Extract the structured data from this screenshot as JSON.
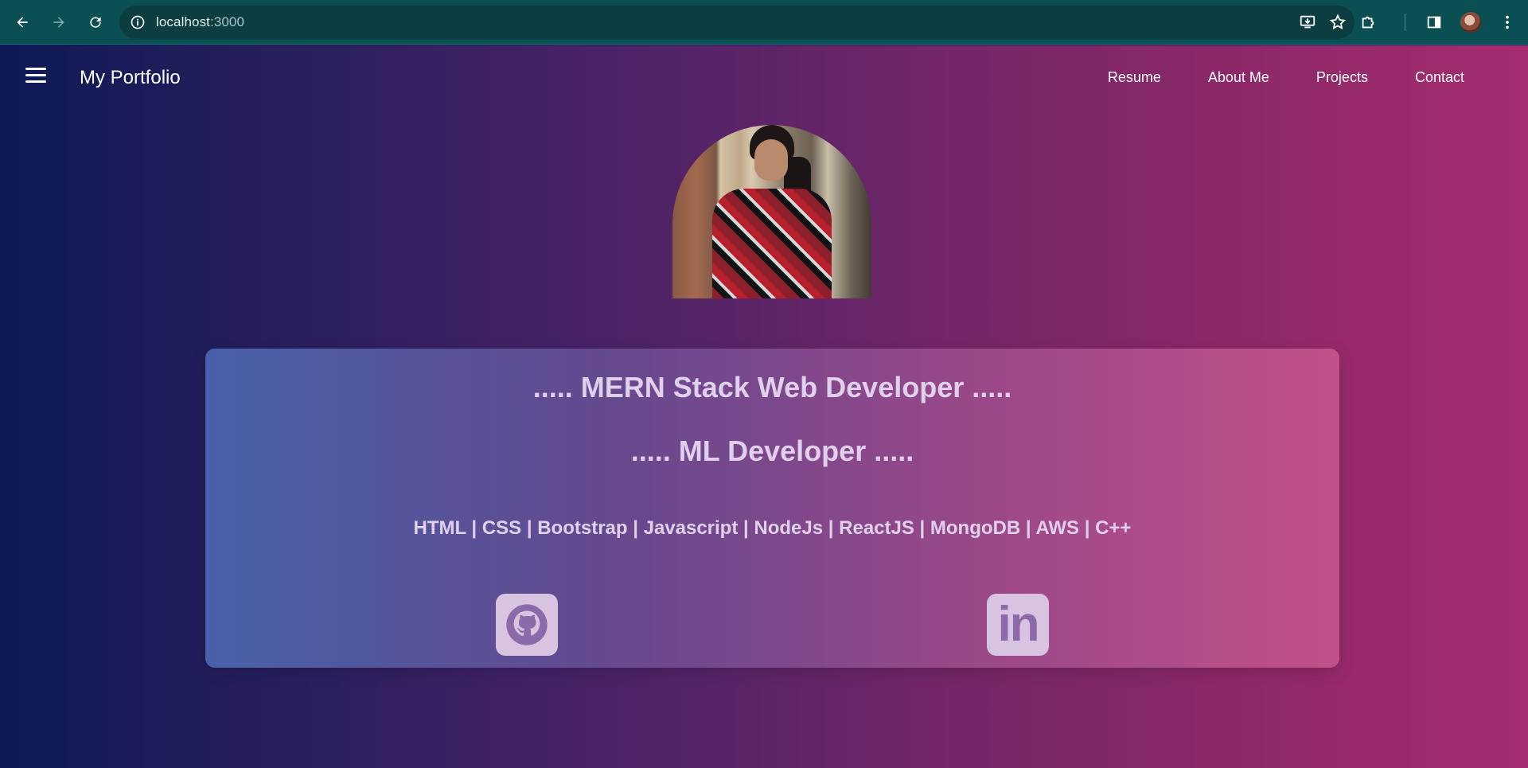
{
  "browser": {
    "url_host": "localhost",
    "url_port": ":3000"
  },
  "nav": {
    "brand": "My Portfolio",
    "links": [
      "Resume",
      "About Me",
      "Projects",
      "Contact"
    ]
  },
  "hero": {
    "title1": "..... MERN Stack Web Developer .....",
    "title2": "..... ML Developer .....",
    "skills": "HTML | CSS | Bootstrap | Javascript | NodeJs | ReactJS | MongoDB | AWS | C++",
    "social": [
      "github-icon",
      "linkedin-icon"
    ],
    "linkedin_text": "in"
  },
  "colors": {
    "chrome_bg": "#0a4f52",
    "page_gradient_start": "#0d1a55",
    "page_gradient_end": "#a52c6f",
    "card_text": "#e0d0eb",
    "icon_bg": "#d8c4e0"
  }
}
